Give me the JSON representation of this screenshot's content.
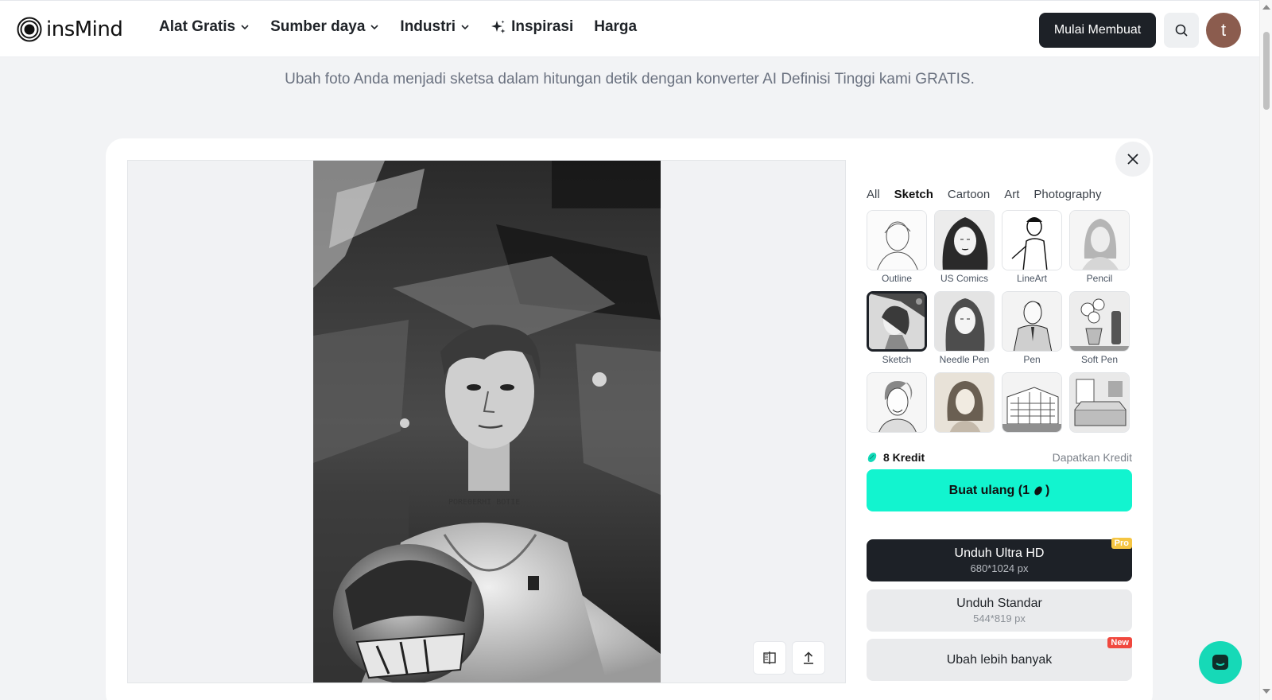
{
  "brand": {
    "name": "insMind"
  },
  "nav": {
    "items": [
      {
        "label": "Alat Gratis",
        "has_dropdown": true
      },
      {
        "label": "Sumber daya",
        "has_dropdown": true
      },
      {
        "label": "Industri",
        "has_dropdown": true
      },
      {
        "label": "Inspirasi",
        "icon": "sparkle-icon"
      },
      {
        "label": "Harga"
      }
    ],
    "create_button": "Mulai Membuat",
    "avatar_initial": "t"
  },
  "subtitle": "Ubah foto Anda menjadi sketsa dalam hitungan detik dengan konverter AI Definisi Tinggi kami GRATIS.",
  "editor": {
    "style_tabs": [
      {
        "label": "All",
        "active": false
      },
      {
        "label": "Sketch",
        "active": true
      },
      {
        "label": "Cartoon",
        "active": false
      },
      {
        "label": "Art",
        "active": false
      },
      {
        "label": "Photography",
        "active": false
      }
    ],
    "styles": [
      {
        "label": "Outline",
        "selected": false
      },
      {
        "label": "US Comics",
        "selected": false
      },
      {
        "label": "LineArt",
        "selected": false
      },
      {
        "label": "Pencil",
        "selected": false
      },
      {
        "label": "Sketch",
        "selected": true
      },
      {
        "label": "Needle Pen",
        "selected": false
      },
      {
        "label": "Pen",
        "selected": false
      },
      {
        "label": "Soft Pen",
        "selected": false
      },
      {
        "label": "",
        "selected": false
      },
      {
        "label": "",
        "selected": false
      },
      {
        "label": "",
        "selected": false
      },
      {
        "label": "",
        "selected": false
      }
    ],
    "credits": "8 Kredit",
    "get_credits": "Dapatkan Kredit",
    "regenerate": "Buat ulang (1",
    "regenerate_close": ")",
    "download_ultra": {
      "label": "Unduh Ultra HD",
      "size": "680*1024 px",
      "badge": "Pro"
    },
    "download_standard": {
      "label": "Unduh Standar",
      "size": "544*819 px"
    },
    "edit_more": {
      "label": "Ubah lebih banyak",
      "badge": "New"
    }
  },
  "colors": {
    "accent": "#12f4cf",
    "dark": "#1d2127",
    "fab": "#16d9b7"
  }
}
